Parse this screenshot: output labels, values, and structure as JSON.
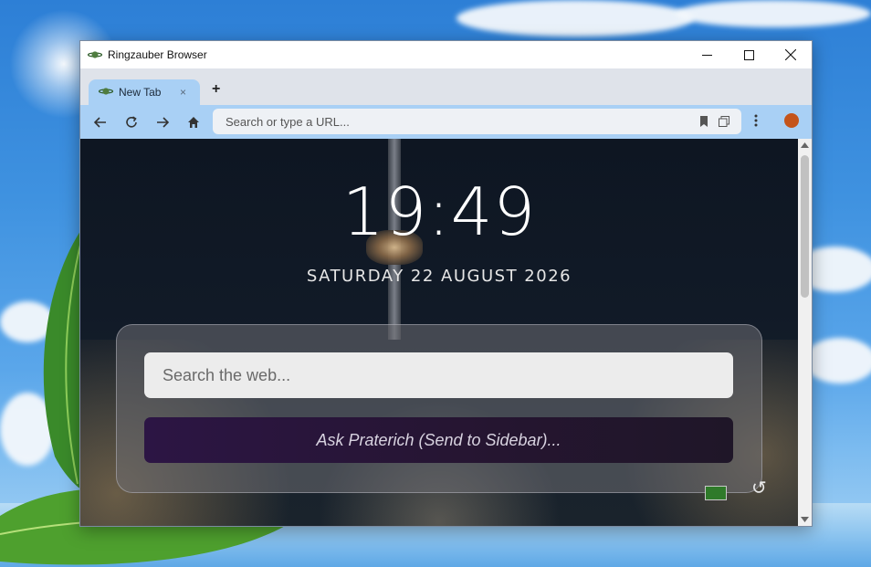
{
  "window": {
    "title": "Ringzauber Browser",
    "controls": [
      "minimize-icon",
      "maximize-icon",
      "close-icon"
    ]
  },
  "tabs": [
    {
      "label": "New Tab",
      "close": "×",
      "icon": "planet-icon",
      "active": true
    }
  ],
  "new_tab_label": "+",
  "toolbar": {
    "back": "arrow-left-icon",
    "reload": "reload-icon",
    "forward": "arrow-right-icon",
    "home": "home-icon",
    "address_placeholder": "Search or type a URL...",
    "address_value": "",
    "bookmark": "bookmark-icon",
    "extensions": "extensions-icon",
    "menu": "kebab-menu-icon",
    "profile": "profile-avatar"
  },
  "newtab_page": {
    "time": "19:49",
    "date": "SATURDAY 22 AUGUST 2026",
    "search_placeholder": "Search the web...",
    "ask_button": "Ask Praterich (Send to Sidebar)...",
    "refresh_icon": "↺"
  },
  "colors": {
    "tab_active": "#a9d0f5",
    "tabstrip": "#dfe3ea",
    "ask_button": "#2c1544",
    "page_background": "#111a27"
  }
}
